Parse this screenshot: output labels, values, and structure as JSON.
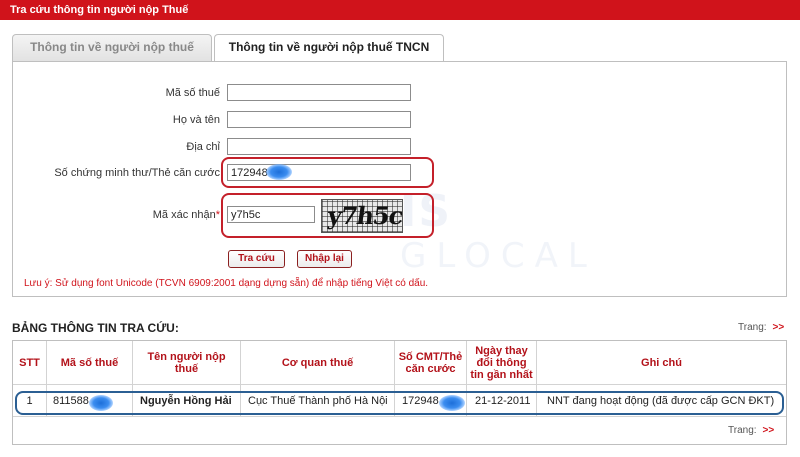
{
  "window": {
    "title": "Tra cứu thông tin người nộp Thuế"
  },
  "tabs": [
    {
      "label": "Thông tin về người nộp thuế",
      "active": false
    },
    {
      "label": "Thông tin về người nộp thuế TNCN",
      "active": true
    }
  ],
  "form": {
    "tax_code": {
      "label": "Mã số thuế",
      "value": ""
    },
    "full_name": {
      "label": "Họ và tên",
      "value": ""
    },
    "address": {
      "label": "Địa chỉ",
      "value": ""
    },
    "id_number": {
      "label": "Số chứng minh thư/Thẻ căn cước",
      "value": "172948"
    },
    "captcha": {
      "label": "Mã xác nhận",
      "required_mark": "*",
      "value": "y7h5c",
      "image_text": "y7h5c"
    },
    "buttons": {
      "search": "Tra cứu",
      "reset": "Nhập lại"
    },
    "note": "Lưu ý: Sử dụng font Unicode (TCVN 6909:2001 dạng dựng sẵn) để nhập tiếng Việt có dấu."
  },
  "watermark": {
    "line1": "IS",
    "line2": "GLOCAL"
  },
  "results": {
    "title": "BẢNG THÔNG TIN TRA CỨU:",
    "pager_label": "Trang:",
    "pager_next": ">>",
    "columns": [
      "STT",
      "Mã số thuế",
      "Tên người nộp thuế",
      "Cơ quan thuế",
      "Số CMT/Thẻ căn cước",
      "Ngày thay đổi thông tin gần nhất",
      "Ghi chú"
    ],
    "rows": [
      {
        "stt": "1",
        "tax_code": "811588",
        "name": "Nguyễn Hồng Hải",
        "agency": "Cục Thuế Thành phố Hà Nội",
        "id_number": "172948",
        "changed": "21-12-2011",
        "note": "NNT đang hoạt động (đã được cấp GCN ĐKT)"
      }
    ]
  },
  "colors": {
    "brand_red": "#d0131b",
    "highlight_blue": "#2b5f93"
  }
}
